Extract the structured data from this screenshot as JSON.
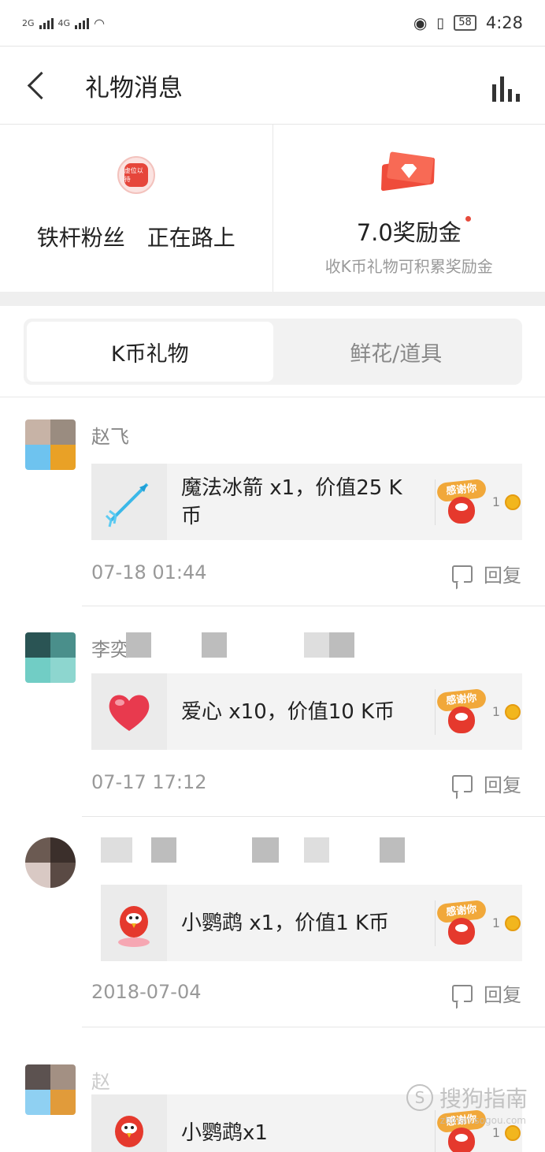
{
  "status_bar": {
    "network1": "2G",
    "network2": "4G",
    "battery": "58",
    "time": "4:28"
  },
  "header": {
    "title": "礼物消息"
  },
  "summary": {
    "fan_text": "铁杆粉丝　正在路上",
    "badge_text": "虚位以待",
    "reward_amount": "7.0奖励金",
    "reward_desc": "收K币礼物可积累奖励金"
  },
  "tabs": [
    {
      "label": "K币礼物",
      "active": true
    },
    {
      "label": "鲜花/道具",
      "active": false
    }
  ],
  "messages": [
    {
      "sender": "赵飞",
      "gift_text": "魔法冰箭 x1，价值25 K币",
      "thanks_label": "感谢你",
      "coin_count": "1",
      "time": "07-18 01:44",
      "reply_label": "回复"
    },
    {
      "sender": "李奕",
      "gift_text": "爱心 x10，价值10 K币",
      "thanks_label": "感谢你",
      "coin_count": "1",
      "time": "07-17 17:12",
      "reply_label": "回复"
    },
    {
      "sender": "",
      "gift_text": "小鹦鹉 x1，价值1 K币",
      "thanks_label": "感谢你",
      "coin_count": "1",
      "time": "2018-07-04",
      "reply_label": "回复"
    },
    {
      "sender": "赵",
      "gift_text": "小鹦鹉x1",
      "thanks_label": "感谢你",
      "coin_count": "1",
      "time": "",
      "reply_label": ""
    }
  ],
  "watermark": {
    "text": "搜狗指南",
    "url": "zhinan.sogou.com"
  },
  "colors": {
    "accent_red": "#e6463b",
    "coin_gold": "#f2b61e",
    "tab_bg": "#f2f2f2"
  }
}
